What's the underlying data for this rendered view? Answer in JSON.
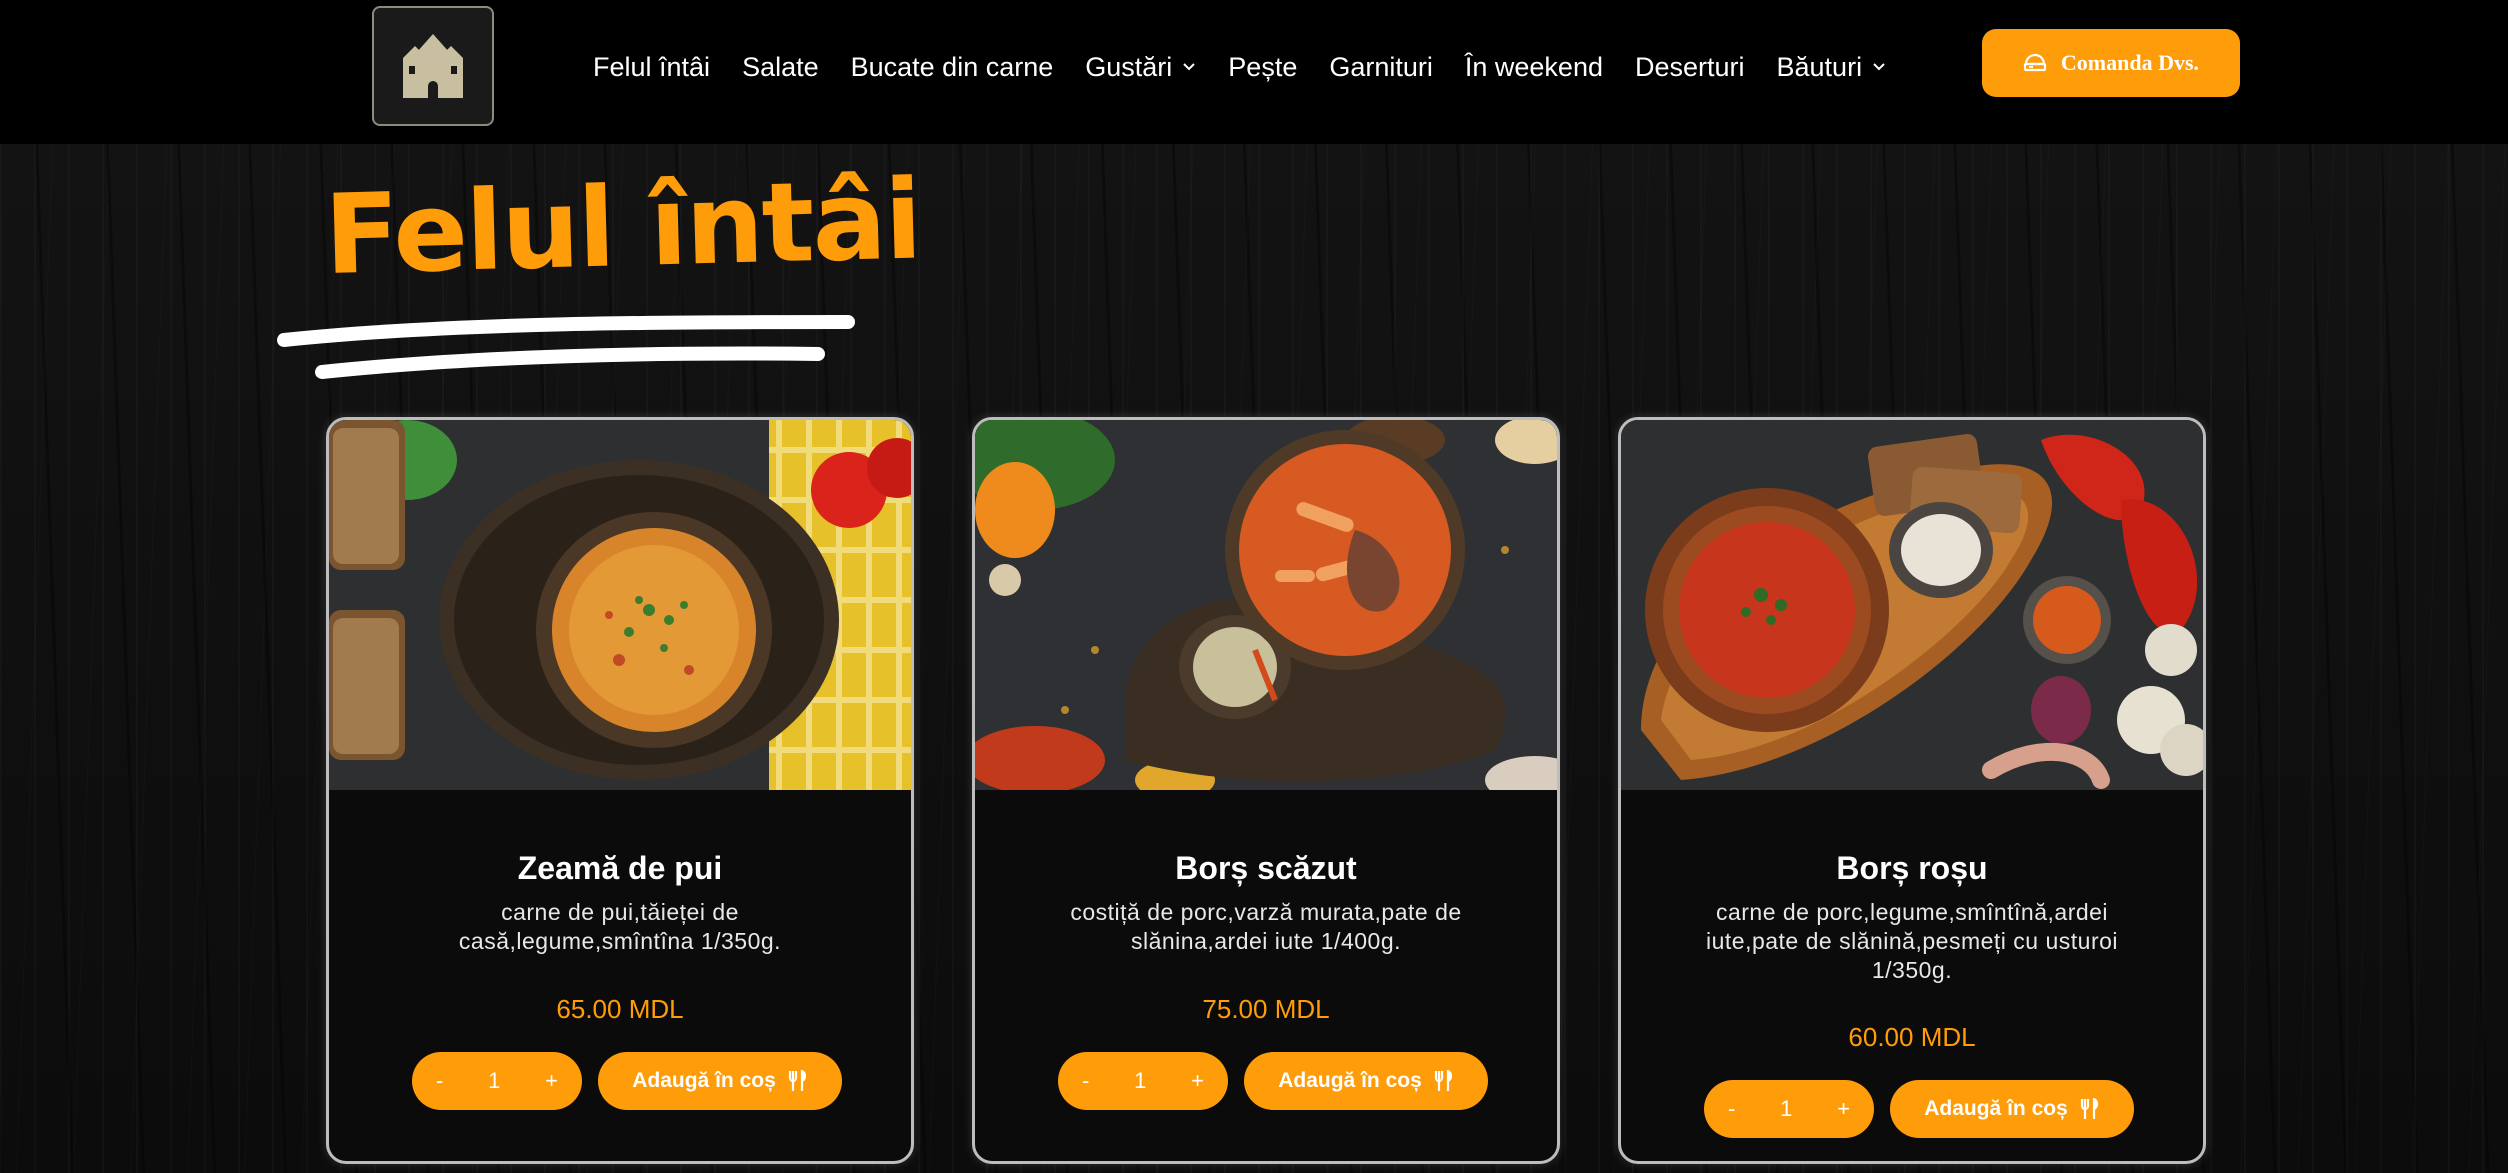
{
  "nav": {
    "items": [
      {
        "label": "Felul întâi",
        "dropdown": false
      },
      {
        "label": "Salate",
        "dropdown": false
      },
      {
        "label": "Bucate din carne",
        "dropdown": false
      },
      {
        "label": "Gustări",
        "dropdown": true
      },
      {
        "label": "Pește",
        "dropdown": false
      },
      {
        "label": "Garnituri",
        "dropdown": false
      },
      {
        "label": "În weekend",
        "dropdown": false
      },
      {
        "label": "Deserturi",
        "dropdown": false
      },
      {
        "label": "Băuturi",
        "dropdown": true
      }
    ],
    "order_button": "Comanda Dvs.",
    "order_icon": "cart-icon"
  },
  "section": {
    "title": "Felul întâi"
  },
  "products": [
    {
      "name": "Zeamă de pui",
      "description": "carne de pui,tăieței de casă,legume,smîntîna 1/350g.",
      "price": "65.00 MDL",
      "quantity": "1",
      "minus": "-",
      "plus": "+",
      "add_label": "Adaugă în coș",
      "image": "chicken-soup-photo"
    },
    {
      "name": "Borș scăzut",
      "description": "costiță de porc,varză murata,pate de slănina,ardei iute 1/400g.",
      "price": "75.00 MDL",
      "quantity": "1",
      "minus": "-",
      "plus": "+",
      "add_label": "Adaugă în coș",
      "image": "sauerkraut-borsch-photo"
    },
    {
      "name": "Borș roșu",
      "description": "carne de porc,legume,smîntînă,ardei iute,pate de slănină,pesmeți cu usturoi 1/350g.",
      "price": "60.00 MDL",
      "quantity": "1",
      "minus": "-",
      "plus": "+",
      "add_label": "Adaugă în coș",
      "image": "red-borsch-photo"
    }
  ],
  "colors": {
    "accent": "#ff9c0a",
    "header_bg": "#000000",
    "text": "#ffffff"
  }
}
